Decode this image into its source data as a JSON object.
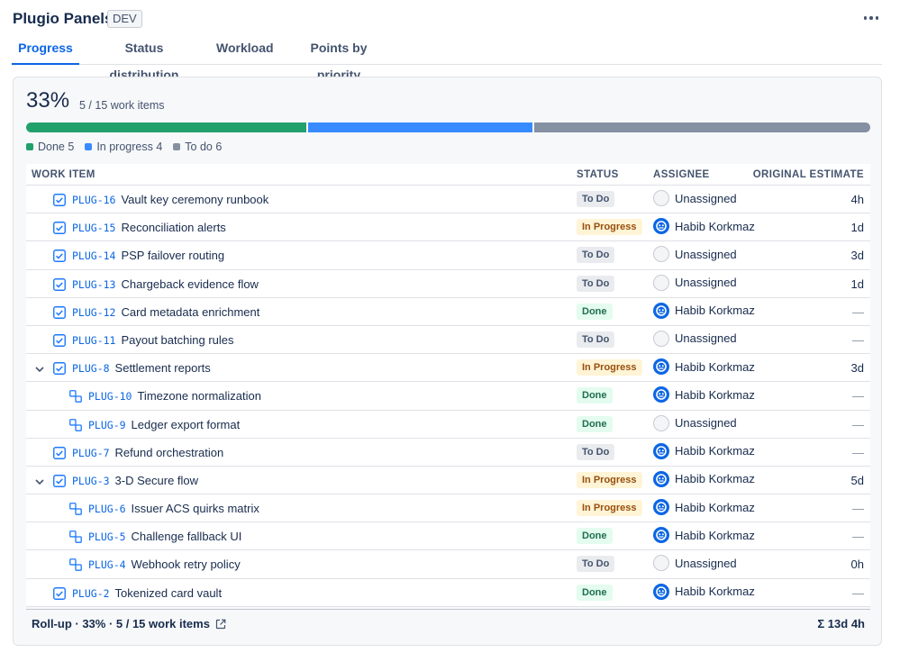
{
  "app": {
    "title": "Plugio Panels",
    "env": "DEV"
  },
  "tabs": [
    {
      "label": "Progress",
      "active": true
    },
    {
      "label": "Status distribution",
      "active": false
    },
    {
      "label": "Workload",
      "active": false
    },
    {
      "label": "Points by priority",
      "active": false
    }
  ],
  "progress": {
    "percent": "33%",
    "count_label": "5 / 15 work items",
    "segments": [
      {
        "key": "done",
        "count": 5,
        "color": "#22a06b"
      },
      {
        "key": "inprog",
        "count": 4,
        "color": "#388bff"
      },
      {
        "key": "todo",
        "count": 6,
        "color": "#8590a2"
      }
    ],
    "legend": [
      {
        "label": "Done 5",
        "color": "#22a06b"
      },
      {
        "label": "In progress 4",
        "color": "#388bff"
      },
      {
        "label": "To do 6",
        "color": "#8590a2"
      }
    ]
  },
  "table": {
    "headers": {
      "item": "WORK ITEM",
      "status": "STATUS",
      "assignee": "ASSIGNEE",
      "estimate": "ORIGINAL ESTIMATE"
    },
    "rows": [
      {
        "key": "PLUG-16",
        "summary": "Vault key ceremony runbook",
        "status": "To Do",
        "status_class": "todo",
        "assignee": "Unassigned",
        "assigned": false,
        "estimate": "4h",
        "level": 0,
        "type": "task",
        "expand": false
      },
      {
        "key": "PLUG-15",
        "summary": "Reconciliation alerts",
        "status": "In Progress",
        "status_class": "inprog",
        "assignee": "Habib Korkmaz",
        "assigned": true,
        "estimate": "1d",
        "level": 0,
        "type": "task",
        "expand": false
      },
      {
        "key": "PLUG-14",
        "summary": "PSP failover routing",
        "status": "To Do",
        "status_class": "todo",
        "assignee": "Unassigned",
        "assigned": false,
        "estimate": "3d",
        "level": 0,
        "type": "task",
        "expand": false
      },
      {
        "key": "PLUG-13",
        "summary": "Chargeback evidence flow",
        "status": "To Do",
        "status_class": "todo",
        "assignee": "Unassigned",
        "assigned": false,
        "estimate": "1d",
        "level": 0,
        "type": "task",
        "expand": false
      },
      {
        "key": "PLUG-12",
        "summary": "Card metadata enrichment",
        "status": "Done",
        "status_class": "done",
        "assignee": "Habib Korkmaz",
        "assigned": true,
        "estimate": "—",
        "level": 0,
        "type": "task",
        "expand": false
      },
      {
        "key": "PLUG-11",
        "summary": "Payout batching rules",
        "status": "To Do",
        "status_class": "todo",
        "assignee": "Unassigned",
        "assigned": false,
        "estimate": "—",
        "level": 0,
        "type": "task",
        "expand": false
      },
      {
        "key": "PLUG-8",
        "summary": "Settlement reports",
        "status": "In Progress",
        "status_class": "inprog",
        "assignee": "Habib Korkmaz",
        "assigned": true,
        "estimate": "3d",
        "level": 0,
        "type": "task",
        "expand": true
      },
      {
        "key": "PLUG-10",
        "summary": "Timezone normalization",
        "status": "Done",
        "status_class": "done",
        "assignee": "Habib Korkmaz",
        "assigned": true,
        "estimate": "—",
        "level": 1,
        "type": "subtask",
        "expand": false
      },
      {
        "key": "PLUG-9",
        "summary": "Ledger export format",
        "status": "Done",
        "status_class": "done",
        "assignee": "Unassigned",
        "assigned": false,
        "estimate": "—",
        "level": 1,
        "type": "subtask",
        "expand": false
      },
      {
        "key": "PLUG-7",
        "summary": "Refund orchestration",
        "status": "To Do",
        "status_class": "todo",
        "assignee": "Habib Korkmaz",
        "assigned": true,
        "estimate": "—",
        "level": 0,
        "type": "task",
        "expand": false
      },
      {
        "key": "PLUG-3",
        "summary": "3-D Secure flow",
        "status": "In Progress",
        "status_class": "inprog",
        "assignee": "Habib Korkmaz",
        "assigned": true,
        "estimate": "5d",
        "level": 0,
        "type": "task",
        "expand": true
      },
      {
        "key": "PLUG-6",
        "summary": "Issuer ACS quirks matrix",
        "status": "In Progress",
        "status_class": "inprog",
        "assignee": "Habib Korkmaz",
        "assigned": true,
        "estimate": "—",
        "level": 1,
        "type": "subtask",
        "expand": false
      },
      {
        "key": "PLUG-5",
        "summary": "Challenge fallback UI",
        "status": "Done",
        "status_class": "done",
        "assignee": "Habib Korkmaz",
        "assigned": true,
        "estimate": "—",
        "level": 1,
        "type": "subtask",
        "expand": false
      },
      {
        "key": "PLUG-4",
        "summary": "Webhook retry policy",
        "status": "To Do",
        "status_class": "todo",
        "assignee": "Unassigned",
        "assigned": false,
        "estimate": "0h",
        "level": 1,
        "type": "subtask",
        "expand": false
      },
      {
        "key": "PLUG-2",
        "summary": "Tokenized card vault",
        "status": "Done",
        "status_class": "done",
        "assignee": "Habib Korkmaz",
        "assigned": true,
        "estimate": "—",
        "level": 0,
        "type": "task",
        "expand": false
      }
    ]
  },
  "footer": {
    "rollup": "Roll-up · 33% · 5 / 15 work items",
    "total": "Σ 13d 4h"
  },
  "icons": {
    "more": "more-horizontal-icon",
    "task": "task-checkbox-icon",
    "subtask": "subtask-icon",
    "chevron": "chevron-down-icon",
    "external": "external-link-icon"
  }
}
